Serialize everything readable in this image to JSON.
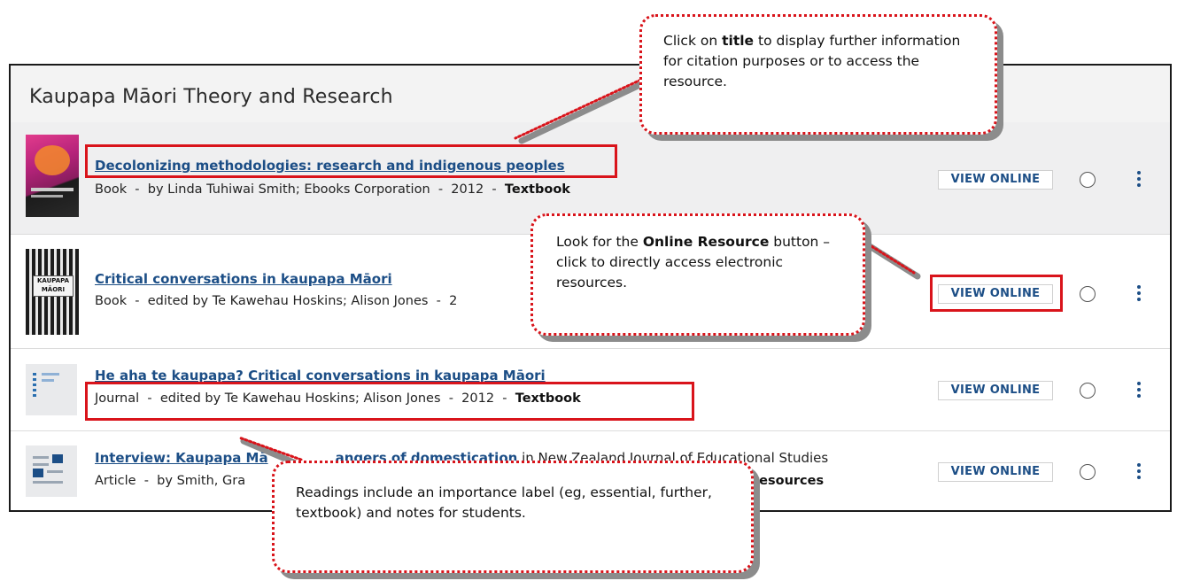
{
  "section": {
    "title": "Kaupapa Māori Theory and Research"
  },
  "readings": [
    {
      "title": "Decolonizing methodologies: research and indigenous peoples",
      "meta_prefix": "Book  -  by Linda Tuhiwai Smith; Ebooks Corporation  -  2012  -  ",
      "importance": "Textbook",
      "button": "VIEW ONLINE",
      "cover": {
        "top_text": "",
        "label": ""
      }
    },
    {
      "title": "Critical conversations in kaupapa Māori",
      "meta_prefix": "Book  -  edited by Te Kawehau Hoskins; Alison Jones  -  2",
      "importance": "",
      "button": "VIEW ONLINE",
      "cover": {
        "label": "KAUPAPA MĀORI"
      }
    },
    {
      "title": "He aha te kaupapa? Critical conversations in kaupapa Māori",
      "meta_prefix": "Journal  -  edited by Te Kawehau Hoskins; Alison Jones  -  2012  -  ",
      "importance": "Textbook",
      "button": "VIEW ONLINE"
    },
    {
      "title": "Interview: Kaupapa Mā",
      "title_tail": "angers of domestication",
      "in_text": " in New Zealand Journal of Educational Studies",
      "meta_prefix": "Article  -  by Smith, Gra",
      "importance": "resources",
      "button": "VIEW ONLINE"
    }
  ],
  "callouts": {
    "title_tip": {
      "pre": "Click on ",
      "bold": "title",
      "post": " to display further information for citation purposes or to access the resource."
    },
    "online_tip": {
      "pre": "Look for the ",
      "bold": "Online Resource",
      "post": " button – click to directly access electronic resources."
    },
    "label_tip": {
      "text": "Readings include an importance label (eg, essential, further, textbook) and notes for students."
    }
  },
  "colors": {
    "accent": "#1c4e86",
    "highlight": "#d9141b"
  }
}
